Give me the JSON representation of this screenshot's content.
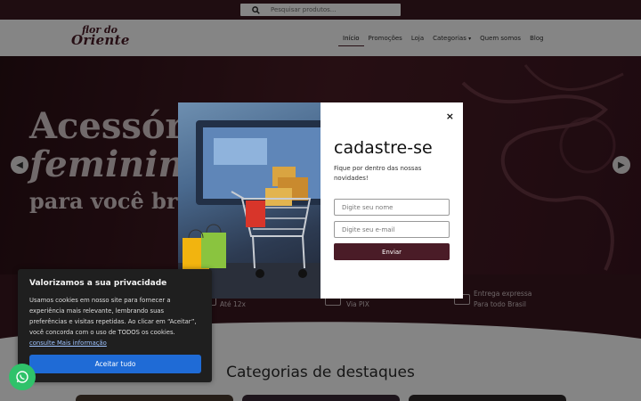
{
  "search": {
    "placeholder": "Pesquisar produtos..."
  },
  "logo": {
    "line1": "flor do",
    "line2": "Oriente",
    "tagline": ""
  },
  "nav": {
    "items": [
      {
        "label": "Início"
      },
      {
        "label": "Promoções"
      },
      {
        "label": "Loja"
      },
      {
        "label": "Categorias"
      },
      {
        "label": "Quem somos"
      },
      {
        "label": "Blog"
      }
    ]
  },
  "hero": {
    "line1": "Acessórios",
    "line2": "femininos",
    "line3": "para você brilhar"
  },
  "features": [
    {
      "title": "",
      "subtitle": "Até 12x"
    },
    {
      "title": "",
      "subtitle": "Via PIX"
    },
    {
      "title": "Entrega expressa",
      "subtitle": "Para todo Brasil"
    }
  ],
  "categories": {
    "title": "Categorias de destaques"
  },
  "modal": {
    "close": "×",
    "title": "cadastre-se",
    "subtitle": "Fique por dentro das nossas novidades!",
    "name_placeholder": "Digite seu nome",
    "email_placeholder": "Digite seu e-mail",
    "submit": "Enviar"
  },
  "cookie": {
    "title": "Valorizamos a sua privacidade",
    "body": "Usamos cookies em nosso site para fornecer a experiência mais relevante, lembrando suas preferências e visitas repetidas. Ao clicar em “Aceitar”, você concorda com o uso de TODOS os cookies.",
    "link": "consulte Mais informação",
    "accept": "Aceitar tudo"
  },
  "colors": {
    "brand": "#4a1c27",
    "cookie_bg": "#1f1f1f",
    "accept_btn": "#1f6bd6",
    "whatsapp": "#2fc26a"
  },
  "icons": [
    "search-icon",
    "chevron-left-icon",
    "chevron-right-icon",
    "close-icon",
    "whatsapp-icon",
    "chevron-down-icon"
  ]
}
